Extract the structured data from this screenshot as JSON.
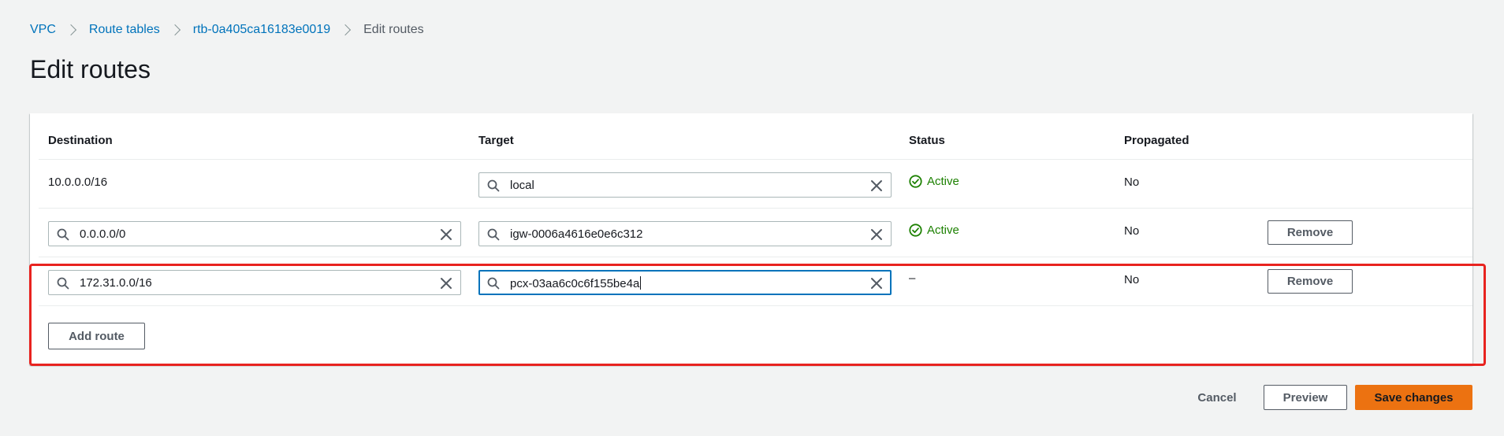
{
  "breadcrumb": {
    "vpc": "VPC",
    "route_tables": "Route tables",
    "route_table_id": "rtb-0a405ca16183e0019",
    "current": "Edit routes"
  },
  "page": {
    "title": "Edit routes"
  },
  "table": {
    "columns": {
      "destination": "Destination",
      "target": "Target",
      "status": "Status",
      "propagated": "Propagated"
    },
    "rows": [
      {
        "destination": "10.0.0.0/16",
        "target": "local",
        "status": "Active",
        "propagated": "No"
      },
      {
        "destination": "0.0.0.0/0",
        "target": "igw-0006a4616e0e6c312",
        "status": "Active",
        "propagated": "No",
        "remove_label": "Remove"
      },
      {
        "destination": "172.31.0.0/16",
        "target": "pcx-03aa6c0c6f155be4a",
        "status": "–",
        "propagated": "No",
        "remove_label": "Remove"
      }
    ],
    "add_route_label": "Add route"
  },
  "actions": {
    "cancel": "Cancel",
    "preview": "Preview",
    "save": "Save changes"
  },
  "colors": {
    "link": "#0073bb",
    "active_status": "#1d8102",
    "primary_button": "#ec7211",
    "focus_border": "#0073bb",
    "highlight": "#e8231f"
  },
  "icons": {
    "search": "search-icon",
    "clear": "close-icon",
    "status_ok": "check-circle-icon",
    "breadcrumb_separator": "chevron-right-icon"
  }
}
